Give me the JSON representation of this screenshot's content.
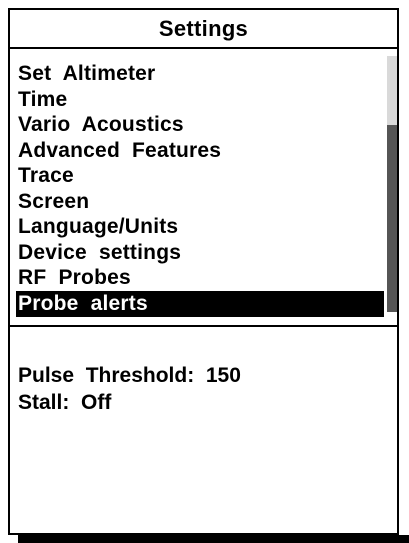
{
  "header": {
    "title": "Settings"
  },
  "menu": {
    "items": [
      {
        "label": "Set  Altimeter"
      },
      {
        "label": "Time"
      },
      {
        "label": "Vario  Acoustics"
      },
      {
        "label": "Advanced  Features"
      },
      {
        "label": "Trace"
      },
      {
        "label": "Screen"
      },
      {
        "label": "Language/Units"
      },
      {
        "label": "Device  settings"
      },
      {
        "label": "RF  Probes"
      },
      {
        "label": "Probe  alerts"
      }
    ],
    "selected_index": 9
  },
  "scrollbar": {
    "position_fraction": 0.27,
    "visible_fraction": 0.73
  },
  "details": {
    "pulse_threshold": "Pulse  Threshold:  150",
    "stall": "Stall:  Off"
  },
  "colors": {
    "foreground": "#000000",
    "background": "#ffffff",
    "selection_bg": "#000000",
    "selection_fg": "#ffffff",
    "scroll_track": "#d9d9d9",
    "scroll_thumb": "#555555"
  }
}
